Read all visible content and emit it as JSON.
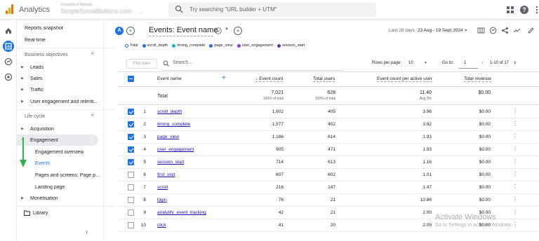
{
  "topbar": {
    "app_title": "Analytics",
    "account_line1": "Consortio & Makeda",
    "account_line2": "SimpleSocialButtons.com - ...",
    "search_placeholder": "Try searching \"URL builder + UTM\""
  },
  "sidebar": {
    "reports_snapshot": "Reports snapshot",
    "realtime": "Real-time",
    "business_objectives": "Business objectives",
    "bo_items": [
      "Leads",
      "Sales",
      "Traffic",
      "User engagement and retenti..."
    ],
    "life_cycle": "Life cycle",
    "acquisition": "Acquisition",
    "engagement": "Engagement",
    "engagement_items": [
      "Engagement overview",
      "Events",
      "Pages and screens: Page p...",
      "Landing page"
    ],
    "monetisation": "Monetisation",
    "library": "Library"
  },
  "header": {
    "avatar_letter": "A",
    "title": "Events: Event name",
    "date_label": "Last 28 days",
    "date_range": "23 Aug - 19 Sept 2024"
  },
  "legend": [
    "Total",
    "scroll_depth",
    "timing_complete",
    "page_view",
    "user_engagement",
    "session_start"
  ],
  "legend_colors": [
    "#1a73e8",
    "#1a73e8",
    "#12b5cb",
    "#1a73e8",
    "#9334e6",
    "#5e35b1"
  ],
  "table_controls": {
    "plot_rows": "Plot rows",
    "search": "Search...",
    "rows_per_page_label": "Rows per page:",
    "rows_per_page": "10",
    "goto_label": "Go to:",
    "goto_value": "1",
    "pagination": "1-10 of 17"
  },
  "columns": {
    "event_name": "Event name",
    "event_count": "Event count",
    "total_users": "Total users",
    "per_user": "Event count per active user",
    "revenue": "Total revenue"
  },
  "totals": {
    "label": "Total",
    "event_count": "7,021",
    "event_count_sub": "100% of total",
    "total_users": "628",
    "total_users_sub": "100% of total",
    "per_user": "11.40",
    "per_user_sub": "Avg 0%",
    "revenue": "$0.00"
  },
  "rows": [
    {
      "n": "1",
      "name": "scroll_depth",
      "count": "1,602",
      "users": "405",
      "per": "3.96",
      "rev": "$0.00",
      "checked": true
    },
    {
      "n": "2",
      "name": "timing_complete",
      "count": "1,577",
      "users": "402",
      "per": "3.92",
      "rev": "$0.00",
      "checked": true
    },
    {
      "n": "3",
      "name": "page_view",
      "count": "1,186",
      "users": "614",
      "per": "1.93",
      "rev": "$0.00",
      "checked": true
    },
    {
      "n": "4",
      "name": "user_engagement",
      "count": "905",
      "users": "471",
      "per": "1.93",
      "rev": "$0.00",
      "checked": true
    },
    {
      "n": "5",
      "name": "session_start",
      "count": "714",
      "users": "613",
      "per": "1.16",
      "rev": "$0.00",
      "checked": true
    },
    {
      "n": "6",
      "name": "first_visit",
      "count": "607",
      "users": "602",
      "per": "1.01",
      "rev": "$0.00",
      "checked": false
    },
    {
      "n": "7",
      "name": "scroll",
      "count": "216",
      "users": "147",
      "per": "1.47",
      "rev": "$0.00",
      "checked": false
    },
    {
      "n": "8",
      "name": "login",
      "count": "76",
      "users": "21",
      "per": "10.86",
      "rev": "$0.00",
      "checked": false
    },
    {
      "n": "9",
      "name": "analytify_event_tracking",
      "count": "42",
      "users": "21",
      "per": "2.00",
      "rev": "$0.00",
      "checked": false
    },
    {
      "n": "10",
      "name": "click",
      "count": "41",
      "users": "20",
      "per": "2.05",
      "rev": "$0.00",
      "checked": false
    }
  ],
  "watermark": {
    "line1": "Activate Windows",
    "line2": "Go to Settings to activate Windows."
  }
}
